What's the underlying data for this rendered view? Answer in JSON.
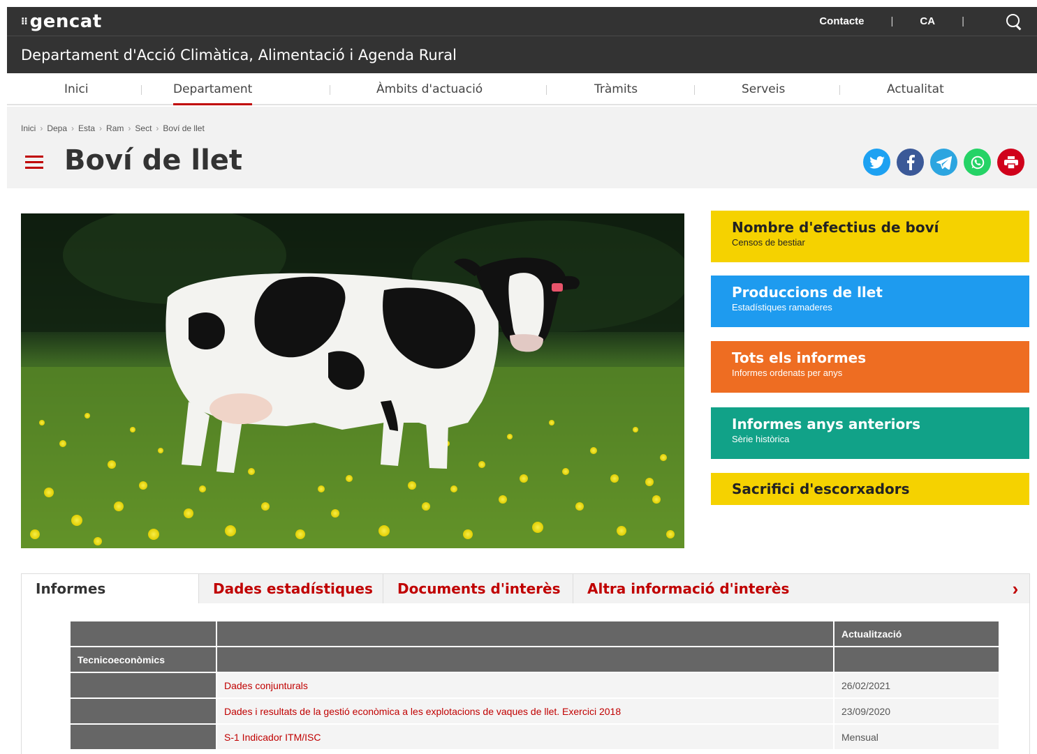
{
  "header": {
    "logo": "gencat",
    "contact": "Contacte",
    "language": "CA",
    "department": "Departament d'Acció Climàtica, Alimentació i Agenda Rural"
  },
  "nav": {
    "items": [
      {
        "label": "Inici"
      },
      {
        "label": "Departament"
      },
      {
        "label": "Àmbits d'actuació"
      },
      {
        "label": "Tràmits"
      },
      {
        "label": "Serveis"
      },
      {
        "label": "Actualitat"
      }
    ],
    "active": "Departament"
  },
  "breadcrumb": [
    "Inici",
    "Depa",
    "Esta",
    "Ram",
    "Sect",
    "Boví de llet"
  ],
  "page_title": "Boví de llet",
  "share_icons": [
    "twitter-icon",
    "facebook-icon",
    "telegram-icon",
    "whatsapp-icon",
    "print-icon"
  ],
  "cards": [
    {
      "title": "Nombre d'efectius de boví",
      "subtitle": "Censos de bestiar",
      "color": "#f5d200",
      "text_color": "#222222"
    },
    {
      "title": "Produccions de llet",
      "subtitle": "Estadístiques ramaderes",
      "color": "#1e9bef",
      "text_color": "#ffffff"
    },
    {
      "title": "Tots els informes",
      "subtitle": "Informes ordenats per anys",
      "color": "#ee6d22",
      "text_color": "#ffffff"
    },
    {
      "title": "Informes anys anteriors",
      "subtitle": "Sèrie històrica",
      "color": "#11a288",
      "text_color": "#ffffff"
    },
    {
      "title": "Sacrifici d'escorxadors",
      "subtitle": "",
      "color": "#f5d200",
      "text_color": "#222222"
    }
  ],
  "tabs": [
    {
      "label": "Informes"
    },
    {
      "label": "Dades estadístiques"
    },
    {
      "label": "Documents d'interès"
    },
    {
      "label": "Altra informació d'interès"
    }
  ],
  "table": {
    "header_update": "Actualització",
    "section": "Tecnicoeconòmics",
    "rows": [
      {
        "title": "Dades conjunturals",
        "update": "26/02/2021"
      },
      {
        "title": "Dades i resultats de la gestió econòmica a les explotacions de vaques de llet. Exercici 2018",
        "update": "23/09/2020"
      },
      {
        "title": "S-1 Indicador ITM/ISC",
        "update": "Mensual"
      }
    ]
  }
}
